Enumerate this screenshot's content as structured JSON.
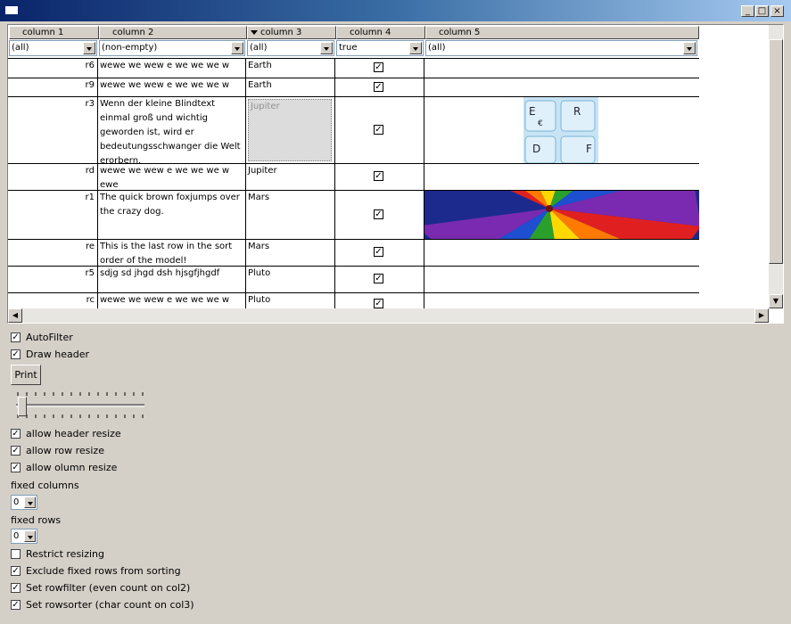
{
  "window": {
    "min_glyph": "_",
    "max_glyph": "□",
    "close_glyph": "×"
  },
  "grid": {
    "columns": [
      "column 1",
      "column 2",
      "column 3",
      "column 4",
      "column 5"
    ],
    "sorted_column": "column 3",
    "filters": [
      "(all)",
      "(non-empty)",
      "(all)",
      "true",
      "(all)"
    ],
    "rows": [
      {
        "id": "r6",
        "text": "wewe we wew e we we we w",
        "planet": "Earth",
        "checked": true,
        "image": ""
      },
      {
        "id": "r9",
        "text": "wewe we wew e we we we w",
        "planet": "Earth",
        "checked": true,
        "image": ""
      },
      {
        "id": "r3",
        "text": "Wenn der kleine Blindtext einmal groß und wichtig geworden ist, wird er bedeutungsschwanger die Welt erorbern.",
        "planet": "Jupiter",
        "checked": true,
        "image": "keyboard-keys-image"
      },
      {
        "id": "rd",
        "text": "wewe we wew e we we we w ewe",
        "planet": "Jupiter",
        "checked": true,
        "image": ""
      },
      {
        "id": "r1",
        "text": "The quick brown foxjumps over the crazy dog.",
        "planet": "Mars",
        "checked": true,
        "image": "hot-air-balloon-image"
      },
      {
        "id": "re",
        "text": "This is the last row in the sort order of the model!",
        "planet": "Mars",
        "checked": true,
        "image": ""
      },
      {
        "id": "r5",
        "text": "sdjg sd jhgd dsh hjsgfjhgdf",
        "planet": "Pluto",
        "checked": true,
        "image": ""
      },
      {
        "id": "rc",
        "text": "wewe we wew e we we we w",
        "planet": "Pluto",
        "checked": true,
        "image": ""
      }
    ],
    "keyboard_keys": [
      "E",
      "R",
      "€",
      "D",
      "F"
    ]
  },
  "controls": {
    "autofilter": "AutoFilter",
    "draw_header": "Draw header",
    "print": "Print",
    "allow_header_resize": "allow header resize",
    "allow_row_resize": "allow row resize",
    "allow_column_resize": "allow olumn resize",
    "fixed_columns_label": "fixed columns",
    "fixed_columns_value": "0",
    "fixed_rows_label": "fixed rows",
    "fixed_rows_value": "0",
    "restrict_resizing": "Restrict resizing",
    "exclude_fixed_rows": "Exclude fixed rows from sorting",
    "set_rowfilter": "Set rowfilter (even count on col2)",
    "set_rowsorter": "Set rowsorter (char count on col3)",
    "slider_value": 0,
    "checkbox_states": {
      "autofilter": true,
      "draw_header": true,
      "allow_header_resize": true,
      "allow_row_resize": true,
      "allow_column_resize": true,
      "restrict_resizing": false,
      "exclude_fixed_rows": true,
      "set_rowfilter": true,
      "set_rowsorter": true
    }
  },
  "colors": {
    "accent": "#0a246a",
    "face": "#d4d0c8"
  }
}
